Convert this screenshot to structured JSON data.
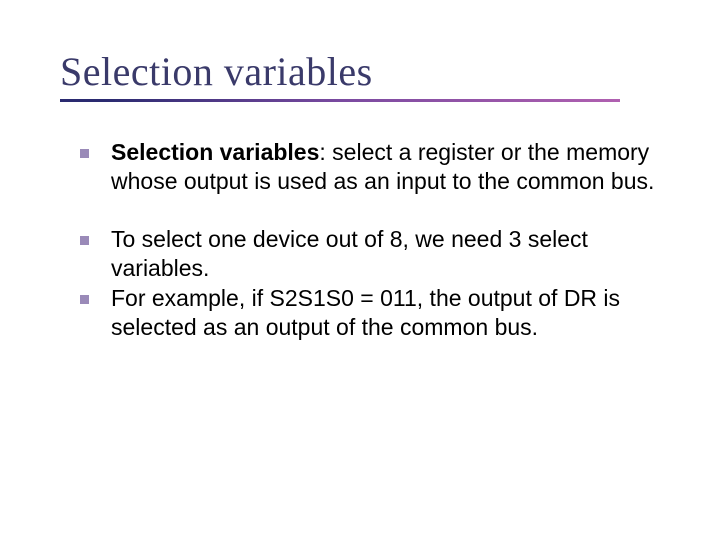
{
  "title": "Selection variables",
  "bullets": [
    {
      "bold_lead": "Selection variables",
      "rest": ": select a register or the memory whose output is used as an input to the common bus."
    },
    {
      "bold_lead": "",
      "rest": "To select one device out of 8, we need 3 select variables."
    },
    {
      "bold_lead": "",
      "rest": "For example, if S2S1S0 = 011, the output of DR is selected as an output of the common bus."
    }
  ]
}
